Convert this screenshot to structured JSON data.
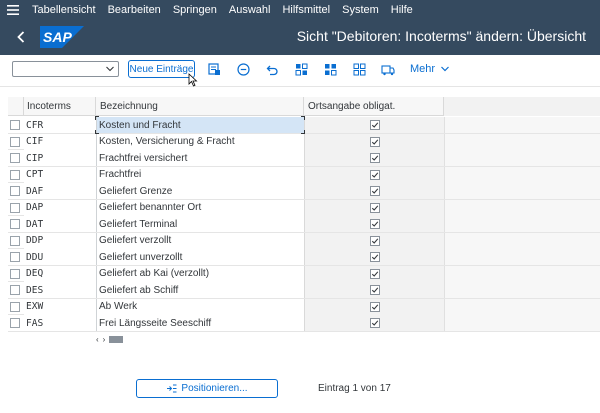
{
  "menubar": {
    "items": [
      "Tabellensicht",
      "Bearbeiten",
      "Springen",
      "Auswahl",
      "Hilfsmittel",
      "System",
      "Hilfe"
    ]
  },
  "titlebar": {
    "logo": "SAP",
    "title": "Sicht \"Debitoren: Incoterms\" ändern: Übersicht"
  },
  "toolbar": {
    "dropdown_value": "",
    "new_entries_label": "Neue Einträge",
    "more_label": "Mehr",
    "icons": [
      "details-icon",
      "delete-icon",
      "undo-icon",
      "select-all-icon",
      "deselect-all-icon",
      "transport-icon"
    ]
  },
  "table": {
    "headers": {
      "incoterms": "Incoterms",
      "bezeichnung": "Bezeichnung",
      "ortsangabe": "Ortsangabe obligat."
    },
    "rows": [
      {
        "code": "CFR",
        "desc": "Kosten und Fracht",
        "checked": true
      },
      {
        "code": "CIF",
        "desc": "Kosten, Versicherung & Fracht",
        "checked": true
      },
      {
        "code": "CIP",
        "desc": "Frachtfrei versichert",
        "checked": true
      },
      {
        "code": "CPT",
        "desc": "Frachtfrei",
        "checked": true
      },
      {
        "code": "DAF",
        "desc": "Geliefert Grenze",
        "checked": true
      },
      {
        "code": "DAP",
        "desc": "Geliefert benannter Ort",
        "checked": true
      },
      {
        "code": "DAT",
        "desc": "Geliefert Terminal",
        "checked": true
      },
      {
        "code": "DDP",
        "desc": "Geliefert verzollt",
        "checked": true
      },
      {
        "code": "DDU",
        "desc": "Geliefert unverzollt",
        "checked": true
      },
      {
        "code": "DEQ",
        "desc": "Geliefert ab Kai (verzollt)",
        "checked": true
      },
      {
        "code": "DES",
        "desc": "Geliefert ab Schiff",
        "checked": true
      },
      {
        "code": "EXW",
        "desc": "Ab Werk",
        "checked": true
      },
      {
        "code": "FAS",
        "desc": "Frei Längsseite Seeschiff",
        "checked": true
      }
    ]
  },
  "footer": {
    "position_label": "Positionieren...",
    "entry_text": "Eintrag 1 von 17"
  },
  "colors": {
    "shell": "#354a5f",
    "accent": "#0a6ed1",
    "selected_cell": "#d4e5f6"
  }
}
